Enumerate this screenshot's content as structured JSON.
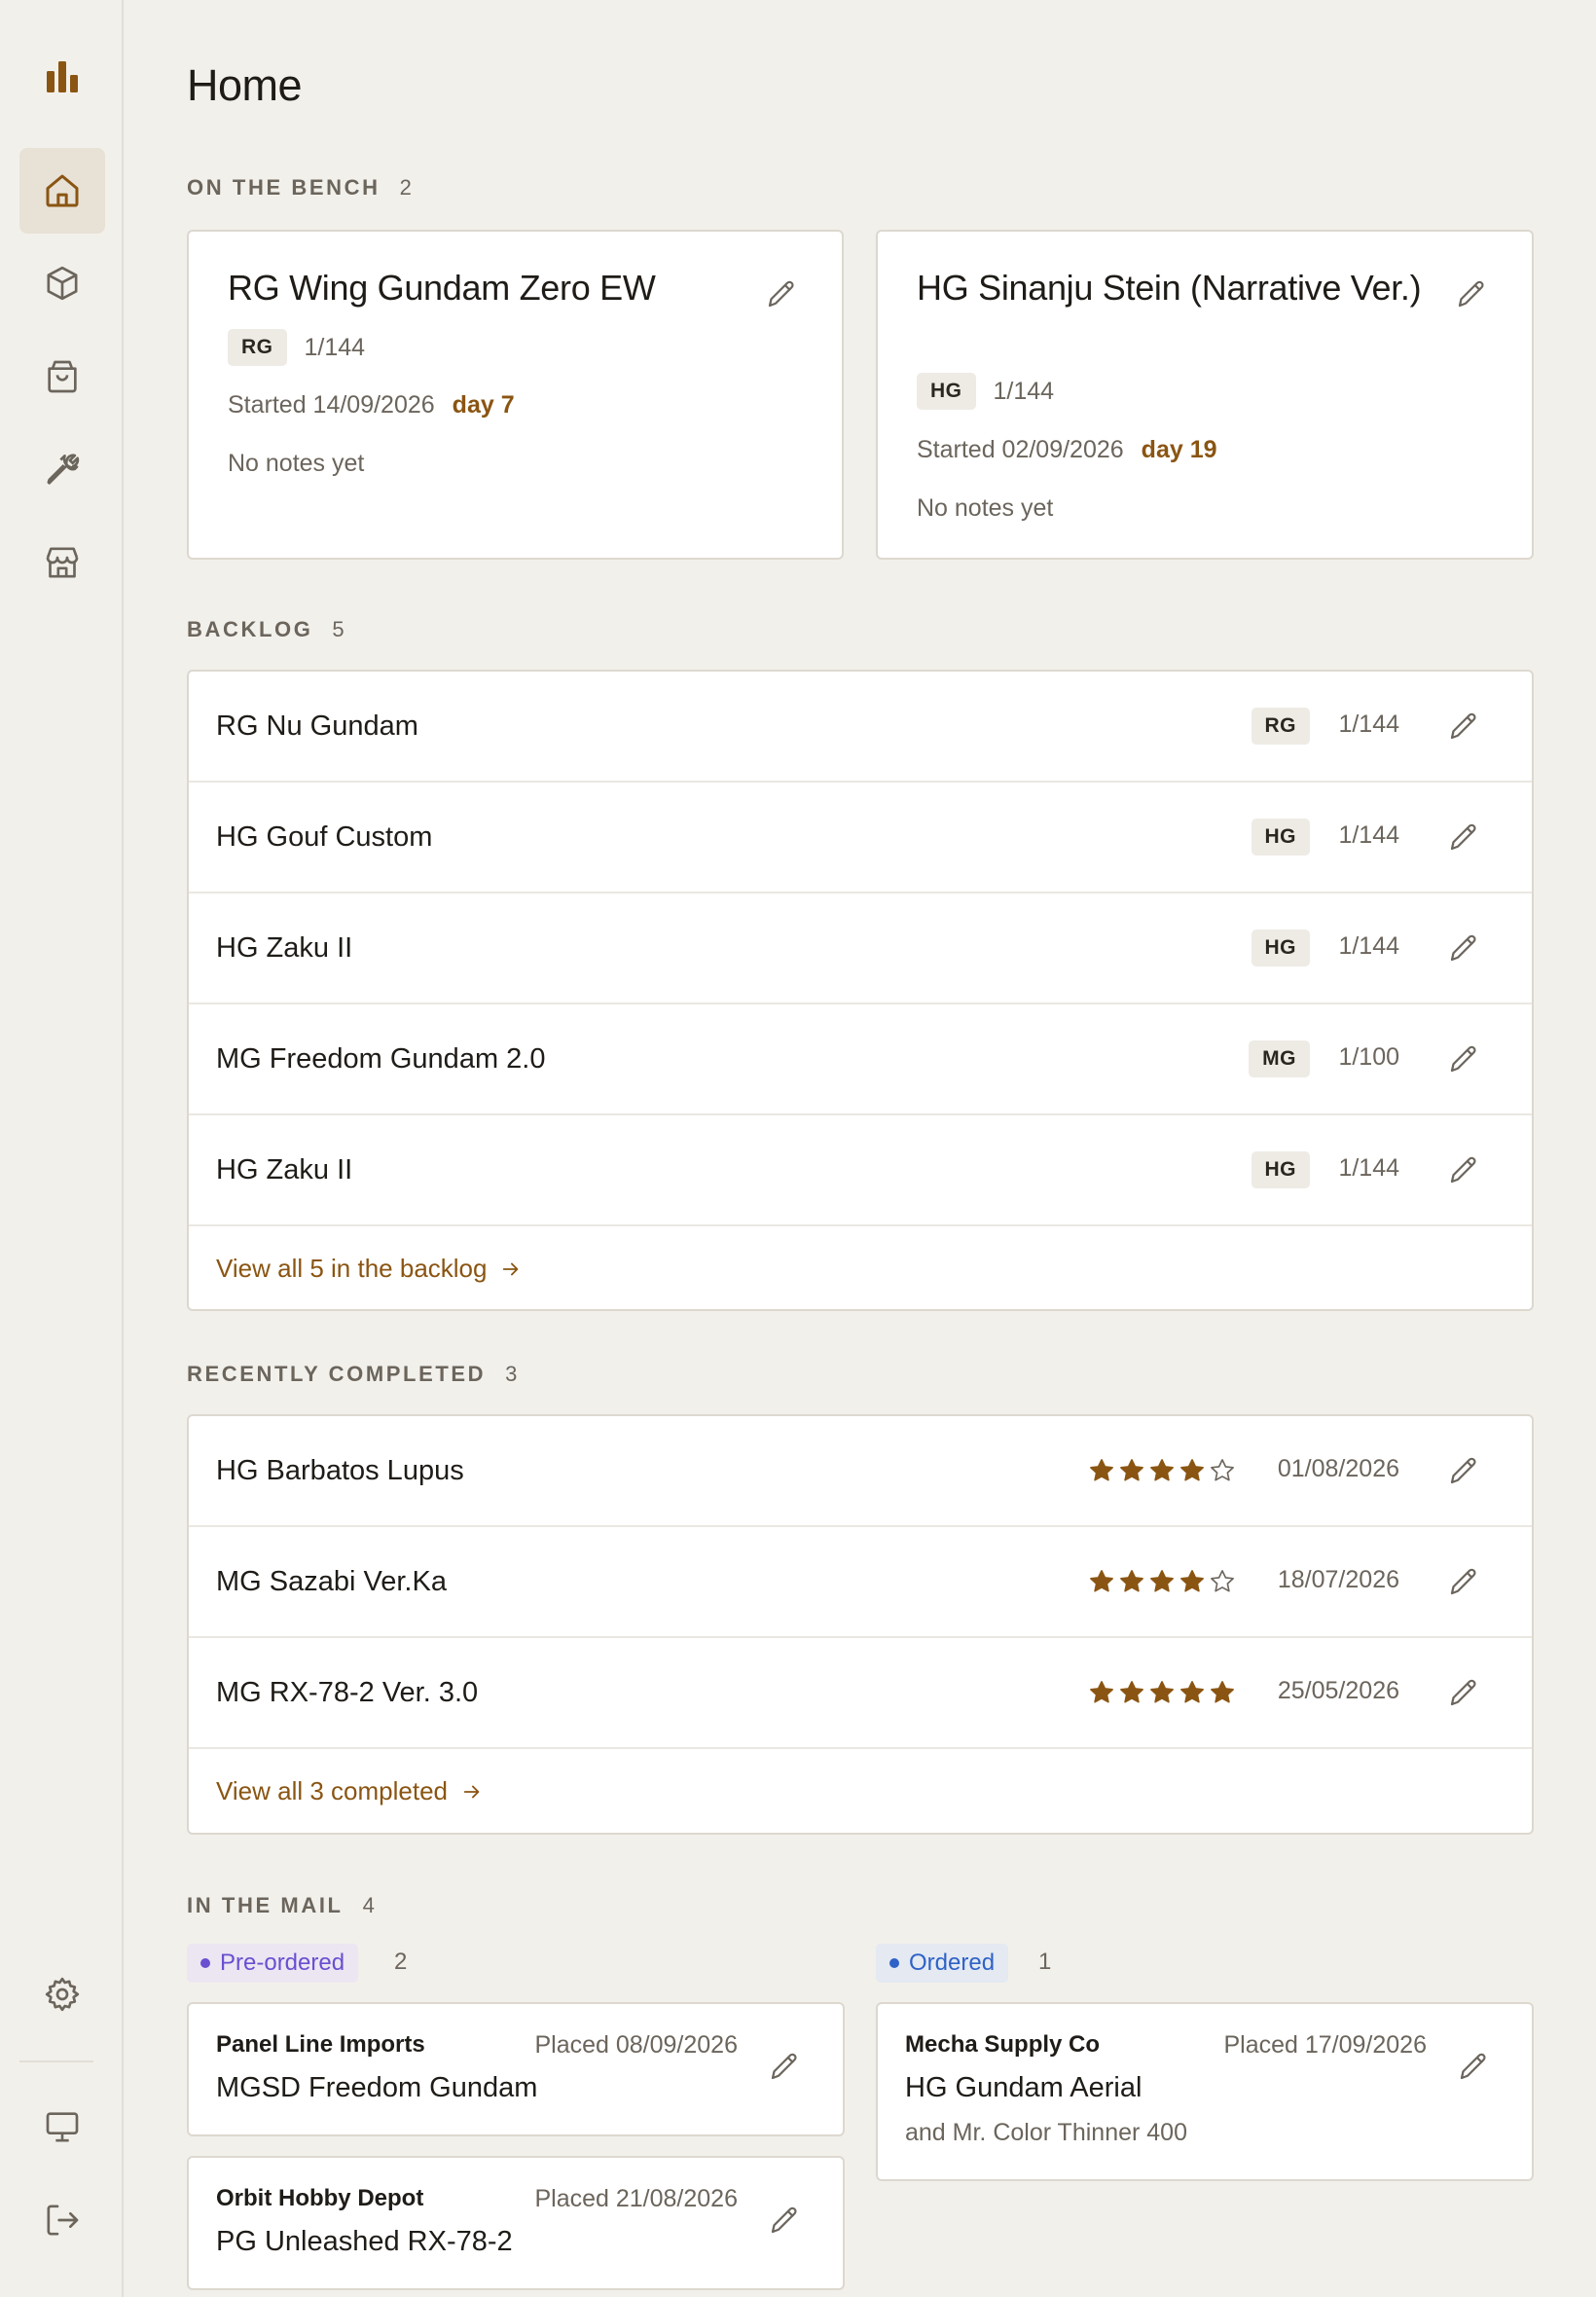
{
  "app": {
    "title": "Home"
  },
  "colors": {
    "accent": "#8a5512",
    "background": "#f2f0eb",
    "preordered": "#6a4fd0",
    "ordered": "#2f62c7"
  },
  "sidebar": {
    "items": [
      {
        "icon": "bar-chart-logo-icon"
      },
      {
        "icon": "home-icon",
        "active": true
      },
      {
        "icon": "box-icon"
      },
      {
        "icon": "shopping-bag-icon"
      },
      {
        "icon": "wrench-icon"
      },
      {
        "icon": "store-icon"
      },
      {
        "icon": "gear-icon"
      },
      {
        "icon": "monitor-icon"
      },
      {
        "icon": "logout-icon"
      }
    ]
  },
  "bench": {
    "label": "On the bench",
    "count": "2",
    "cards": [
      {
        "title": "RG Wing Gundam Zero EW",
        "grade": "RG",
        "scale": "1/144",
        "started": "Started 14/09/2026",
        "day": "day 7",
        "notes": "No notes yet"
      },
      {
        "title": "HG Sinanju Stein (Narrative Ver.)",
        "grade": "HG",
        "scale": "1/144",
        "started": "Started 02/09/2026",
        "day": "day 19",
        "notes": "No notes yet"
      }
    ]
  },
  "backlog": {
    "label": "Backlog",
    "count": "5",
    "items": [
      {
        "name": "RG Nu Gundam",
        "grade": "RG",
        "scale": "1/144"
      },
      {
        "name": "HG Gouf Custom",
        "grade": "HG",
        "scale": "1/144"
      },
      {
        "name": "HG Zaku II",
        "grade": "HG",
        "scale": "1/144"
      },
      {
        "name": "MG Freedom Gundam 2.0",
        "grade": "MG",
        "scale": "1/100"
      },
      {
        "name": "HG Zaku II",
        "grade": "HG",
        "scale": "1/144"
      }
    ],
    "view_all": "View all 5 in the backlog"
  },
  "completed": {
    "label": "Recently completed",
    "count": "3",
    "items": [
      {
        "name": "HG Barbatos Lupus",
        "rating": 4,
        "date": "01/08/2026"
      },
      {
        "name": "MG Sazabi Ver.Ka",
        "rating": 4,
        "date": "18/07/2026"
      },
      {
        "name": "MG RX-78-2 Ver. 3.0",
        "rating": 5,
        "date": "25/05/2026"
      }
    ],
    "view_all": "View all 3 completed"
  },
  "mail": {
    "label": "In the mail",
    "count": "4",
    "preordered": {
      "label": "Pre-ordered",
      "count": "2",
      "cards": [
        {
          "vendor": "Panel Line Imports",
          "placed": "Placed 08/09/2026",
          "item": "MGSD Freedom Gundam"
        },
        {
          "vendor": "Orbit Hobby Depot",
          "placed": "Placed 21/08/2026",
          "item": "PG Unleashed RX-78-2"
        }
      ]
    },
    "ordered": {
      "label": "Ordered",
      "count": "1",
      "cards": [
        {
          "vendor": "Mecha Supply Co",
          "placed": "Placed 17/09/2026",
          "item": "HG Gundam Aerial",
          "extra": "and Mr. Color Thinner 400"
        }
      ]
    }
  }
}
